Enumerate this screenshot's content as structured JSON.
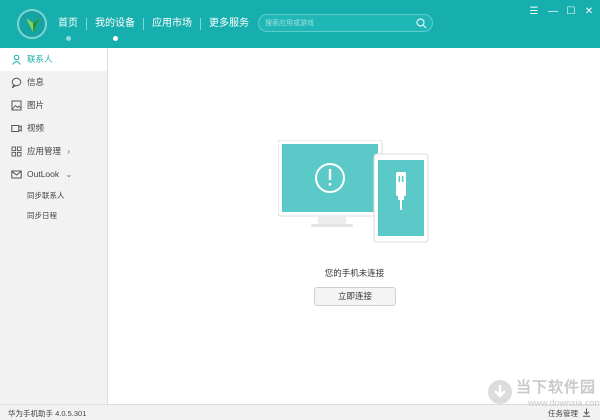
{
  "header": {
    "nav": [
      {
        "label": "首页",
        "dot": "dim"
      },
      {
        "label": "我的设备",
        "dot": "active"
      },
      {
        "label": "应用市场",
        "dot": ""
      },
      {
        "label": "更多服务",
        "dot": ""
      }
    ],
    "search_placeholder": "搜索应用或游戏",
    "window_controls": [
      "☰",
      "—",
      "☐",
      "✕"
    ]
  },
  "sidebar": {
    "items": [
      {
        "label": "联系人",
        "icon": "person-icon",
        "active": true
      },
      {
        "label": "信息",
        "icon": "message-icon"
      },
      {
        "label": "图片",
        "icon": "image-icon"
      },
      {
        "label": "视频",
        "icon": "video-icon"
      },
      {
        "label": "应用管理",
        "icon": "apps-icon",
        "chevron": "›"
      },
      {
        "label": "OutLook",
        "icon": "mail-icon",
        "chevron": "⌄"
      }
    ],
    "sub_items": [
      "同步联系人",
      "同步日程"
    ]
  },
  "main": {
    "status_text": "您的手机未连接",
    "connect_button": "立即连接"
  },
  "statusbar": {
    "version": "华为手机助手 4.0.5.301",
    "task_manager": "任务管理"
  },
  "watermark": {
    "text": "当下软件园",
    "url": "www.downxia.com"
  },
  "colors": {
    "header": "#17aeae",
    "accent": "#17aeae",
    "illustration": "#5cc9c9"
  }
}
